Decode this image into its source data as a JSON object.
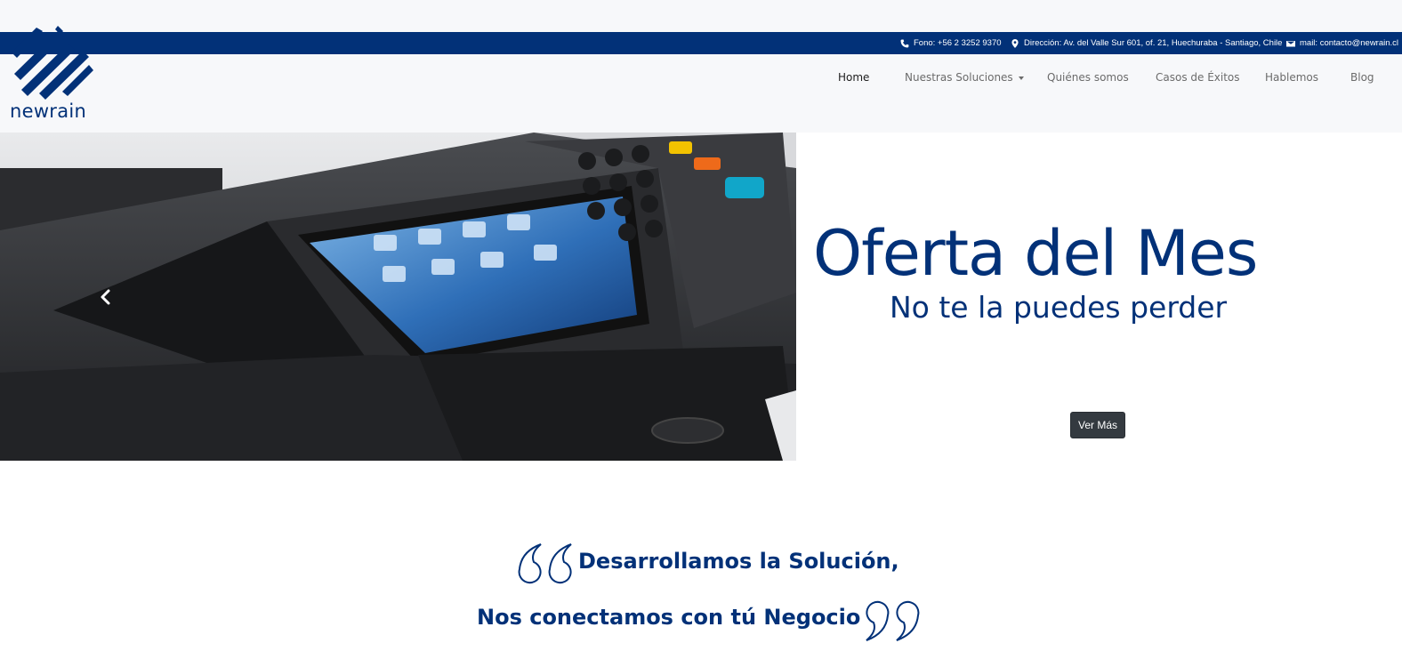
{
  "contact": {
    "phone": "Fono: +56 2 3252 9370",
    "address": "Dirección: Av. del Valle Sur 601, of. 21, Huechuraba - Santiago, Chile",
    "email": "mail: contacto@newrain.cl"
  },
  "brand": {
    "name": "newrain",
    "color": "#023178"
  },
  "nav": {
    "items": [
      {
        "label": "Home"
      },
      {
        "label": "Nuestras Soluciones"
      },
      {
        "label": "Quiénes somos"
      },
      {
        "label": "Casos de Éxitos"
      },
      {
        "label": "Hablemos"
      },
      {
        "label": "Blog"
      }
    ]
  },
  "hero": {
    "title": "Oferta del Mes",
    "subtitle": "No te la puedes perder",
    "button_label": "Ver Más"
  },
  "tagline": {
    "line1": "Desarrollamos la Solución,",
    "line2": "Nos conectamos con tú Negocio"
  }
}
